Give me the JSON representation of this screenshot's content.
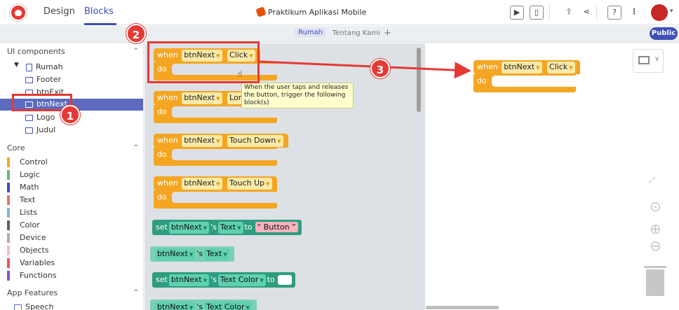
{
  "topbar": {
    "tabs": [
      "Design",
      "Blocks"
    ],
    "active_tab": "Blocks",
    "project_title": "Praktikum Aplikasi Mobile",
    "icons": [
      "play-icon",
      "phone-icon",
      "export-icon",
      "share-icon",
      "help-icon",
      "more-icon"
    ]
  },
  "screenbar": {
    "tabs": [
      "Rumah",
      "Tentang Kami"
    ],
    "add": "+",
    "public_label": "Public"
  },
  "sidebar": {
    "ui_components": {
      "title": "UI components",
      "items": [
        "Rumah",
        "Footer",
        "btnExit",
        "btnNext",
        "Logo",
        "Judul"
      ],
      "selected": "btnNext"
    },
    "core": {
      "title": "Core",
      "categories": [
        {
          "label": "Control",
          "color": "#f4a623"
        },
        {
          "label": "Logic",
          "color": "#66bb6a"
        },
        {
          "label": "Math",
          "color": "#3f51b5"
        },
        {
          "label": "Text",
          "color": "#e57373"
        },
        {
          "label": "Lists",
          "color": "#81b4e0"
        },
        {
          "label": "Color",
          "color": "#616161"
        },
        {
          "label": "Device",
          "color": "#bcaaa4"
        },
        {
          "label": "Objects",
          "color": "#f8bbd0"
        },
        {
          "label": "Variables",
          "color": "#ef5350"
        },
        {
          "label": "Functions",
          "color": "#7e57c2"
        }
      ]
    },
    "app_features": {
      "title": "App Features",
      "items": [
        "Speech"
      ]
    }
  },
  "drawer": {
    "blocks": [
      {
        "when": "when",
        "component": "btnNext",
        "event": "Click",
        "do": "do"
      },
      {
        "when": "when",
        "component": "btnNext",
        "event": "Long Click",
        "do": "do"
      },
      {
        "when": "when",
        "component": "btnNext",
        "event": "Touch Down",
        "do": "do"
      },
      {
        "when": "when",
        "component": "btnNext",
        "event": "Touch Up",
        "do": "do"
      }
    ],
    "set_text": {
      "set": "set",
      "component": "btnNext",
      "s": "'s",
      "prop": "Text",
      "to": "to",
      "value": "Button"
    },
    "get_text": {
      "component": "btnNext",
      "s": "'s",
      "prop": "Text"
    },
    "set_color": {
      "set": "set",
      "component": "btnNext",
      "s": "'s",
      "prop": "Text Color",
      "to": "to"
    },
    "get_color": {
      "component": "btnNext",
      "s": "'s",
      "prop": "Text Color"
    },
    "tooltip": "When the user taps and releases the button, trigger the following block(s)"
  },
  "workspace": {
    "block": {
      "when": "when",
      "component": "btnNext",
      "event": "Click",
      "do": "do"
    }
  },
  "annotations": {
    "badges": [
      "1",
      "2",
      "3"
    ],
    "color": "#e53935"
  }
}
